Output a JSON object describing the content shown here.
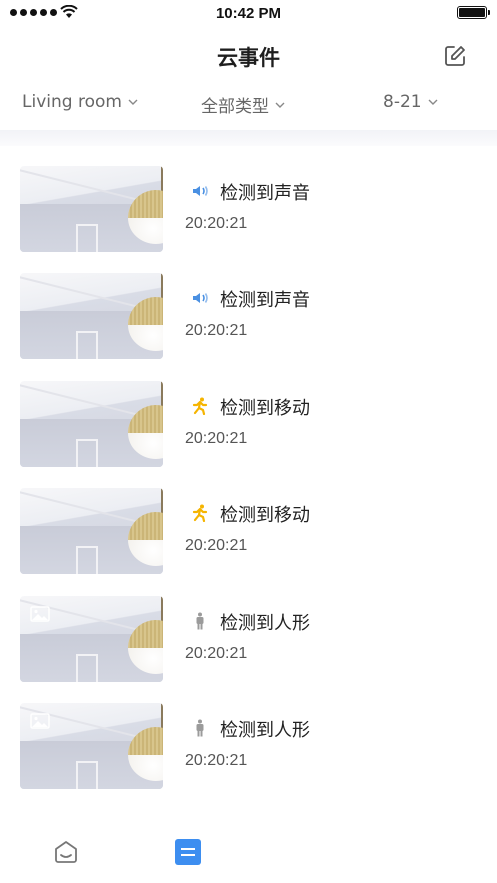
{
  "status_bar": {
    "time": "10:42 PM"
  },
  "header": {
    "title": "云事件"
  },
  "filters": {
    "room": "Living room",
    "type": "全部类型",
    "date": "8-21"
  },
  "events": [
    {
      "icon": "sound-icon",
      "title": "检测到声音",
      "time": "20:20:21"
    },
    {
      "icon": "sound-icon",
      "title": "检测到声音",
      "time": "20:20:21"
    },
    {
      "icon": "motion-icon",
      "title": "检测到移动",
      "time": "20:20:21"
    },
    {
      "icon": "motion-icon",
      "title": "检测到移动",
      "time": "20:20:21"
    },
    {
      "icon": "person-icon",
      "title": "检测到人形",
      "time": "20:20:21"
    },
    {
      "icon": "person-icon",
      "title": "检测到人形",
      "time": "20:20:21"
    }
  ],
  "colors": {
    "sound": "#4a90e2",
    "motion": "#f5b400",
    "person": "#9b9b9b",
    "tab_active": "#3d8ef0",
    "tab_inactive": "#777777"
  },
  "tabs": [
    {
      "icon": "home-icon"
    },
    {
      "icon": "events-icon"
    },
    {
      "icon": "more-icon"
    }
  ]
}
